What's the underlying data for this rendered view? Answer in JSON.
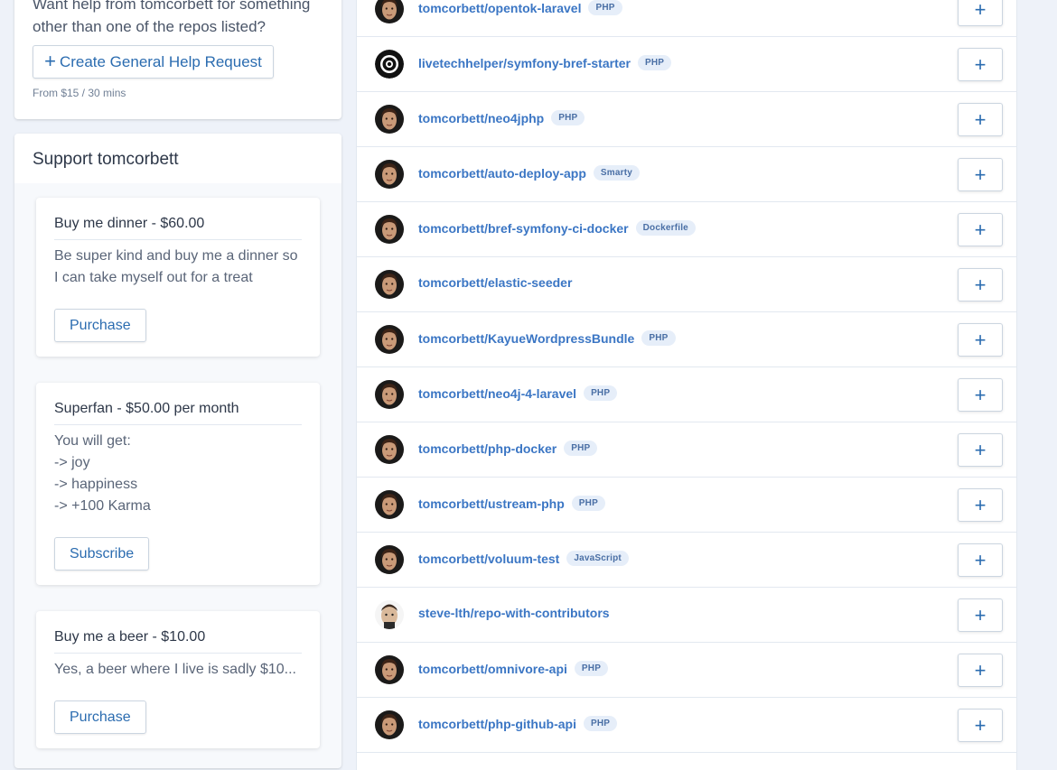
{
  "help_card": {
    "text": "Want help from tomcorbett for something other than one of the repos listed?",
    "button_label": "Create General Help Request",
    "price_note": "From $15 / 30 mins"
  },
  "support": {
    "title": "Support tomcorbett",
    "tiers": [
      {
        "title": "Buy me dinner - $60.00",
        "description": "Be super kind and buy me a dinner so I can take myself out for a treat",
        "button_label": "Purchase"
      },
      {
        "title": "Superfan - $50.00 per month",
        "description": "You will get:\n-> joy\n-> happiness\n-> +100 Karma",
        "button_label": "Subscribe"
      },
      {
        "title": "Buy me a beer - $10.00",
        "description": "Yes, a beer where I live is sadly $10...",
        "button_label": "Purchase"
      }
    ]
  },
  "repos": [
    {
      "name": "tomcorbett/opentok-laravel",
      "language": "PHP",
      "avatar": "person"
    },
    {
      "name": "livetechhelper/symfony-bref-starter",
      "language": "PHP",
      "avatar": "target"
    },
    {
      "name": "tomcorbett/neo4jphp",
      "language": "PHP",
      "avatar": "person"
    },
    {
      "name": "tomcorbett/auto-deploy-app",
      "language": "Smarty",
      "avatar": "person"
    },
    {
      "name": "tomcorbett/bref-symfony-ci-docker",
      "language": "Dockerfile",
      "avatar": "person"
    },
    {
      "name": "tomcorbett/elastic-seeder",
      "language": "",
      "avatar": "person"
    },
    {
      "name": "tomcorbett/KayueWordpressBundle",
      "language": "PHP",
      "avatar": "person"
    },
    {
      "name": "tomcorbett/neo4j-4-laravel",
      "language": "PHP",
      "avatar": "person"
    },
    {
      "name": "tomcorbett/php-docker",
      "language": "PHP",
      "avatar": "person"
    },
    {
      "name": "tomcorbett/ustream-php",
      "language": "PHP",
      "avatar": "person"
    },
    {
      "name": "tomcorbett/voluum-test",
      "language": "JavaScript",
      "avatar": "person"
    },
    {
      "name": "steve-lth/repo-with-contributors",
      "language": "",
      "avatar": "person-light"
    },
    {
      "name": "tomcorbett/omnivore-api",
      "language": "PHP",
      "avatar": "person"
    },
    {
      "name": "tomcorbett/php-github-api",
      "language": "PHP",
      "avatar": "person"
    }
  ],
  "add_button_icon": "plus-icon",
  "colors": {
    "accent": "#2b6cb0",
    "repo_link": "#3b76c4",
    "page_bg": "#eef2f9",
    "badge_bg": "#e6eef9"
  }
}
